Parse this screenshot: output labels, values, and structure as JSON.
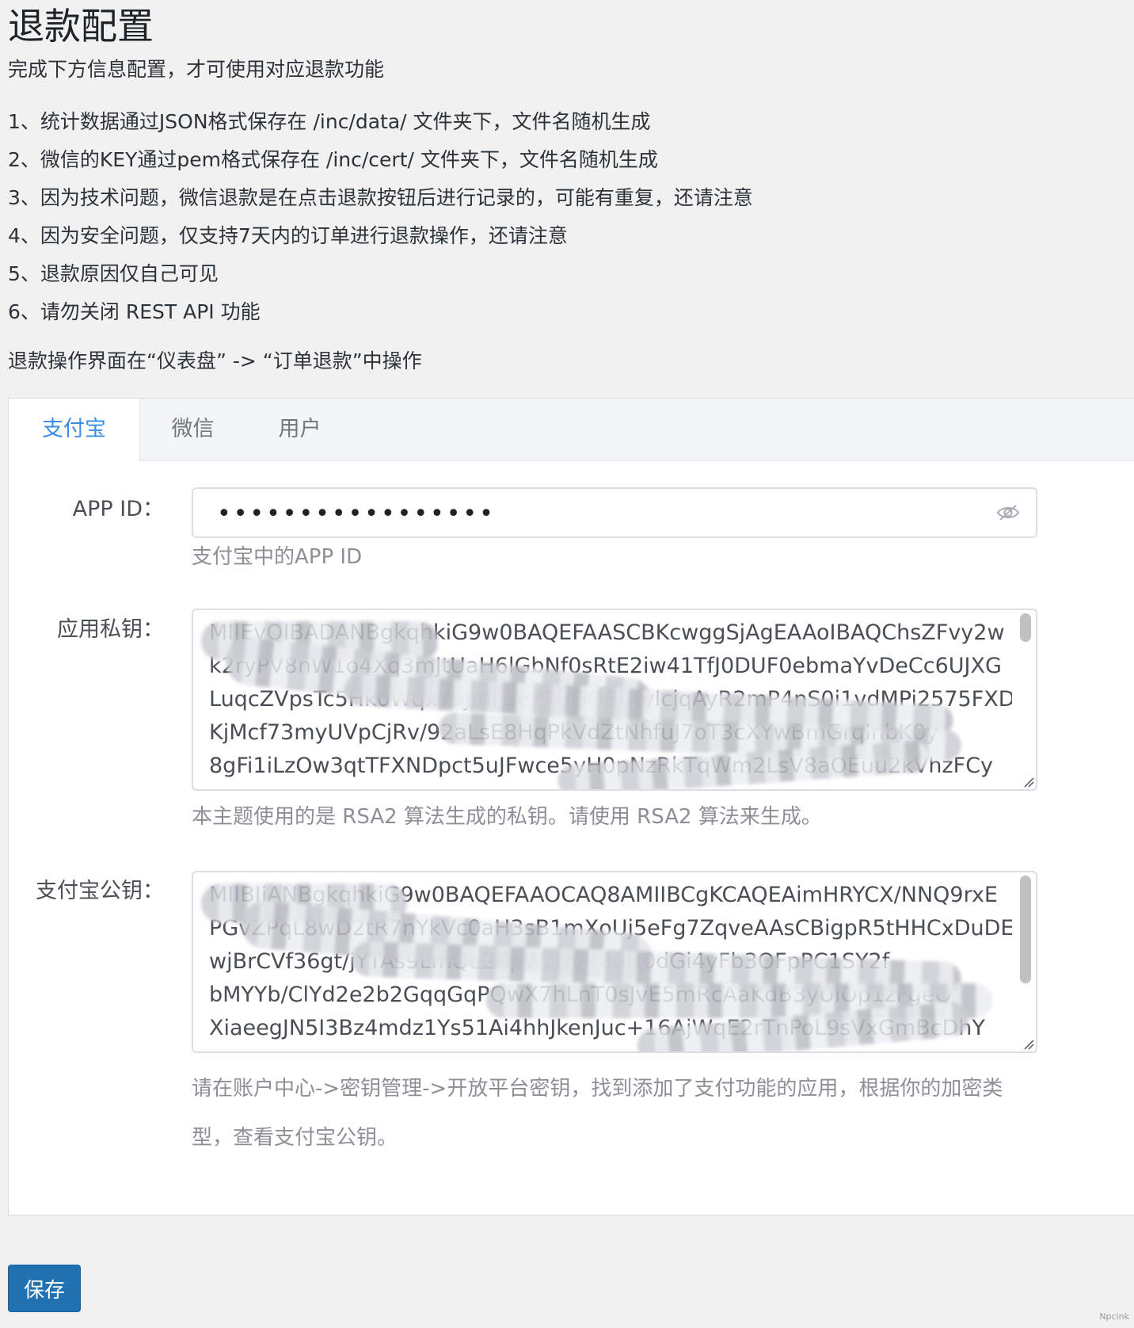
{
  "page": {
    "title": "退款配置",
    "subtitle": "完成下方信息配置，才可使用对应退款功能",
    "notes": [
      "1、统计数据通过JSON格式保存在 /inc/data/ 文件夹下，文件名随机生成",
      "2、微信的KEY通过pem格式保存在 /inc/cert/ 文件夹下，文件名随机生成",
      "3、因为技术问题，微信退款是在点击退款按钮后进行记录的，可能有重复，还请注意",
      "4、因为安全问题，仅支持7天内的订单进行退款操作，还请注意",
      "5、退款原因仅自己可见",
      "6、请勿关闭 REST API 功能"
    ],
    "nav_tip": "退款操作界面在“仪表盘” -> “订单退款”中操作"
  },
  "tabs": [
    {
      "label": "支付宝",
      "active": true
    },
    {
      "label": "微信",
      "active": false
    },
    {
      "label": "用户",
      "active": false
    }
  ],
  "form": {
    "app_id": {
      "label": "APP ID：",
      "value": "•••••••••••••••••",
      "help": "支付宝中的APP ID"
    },
    "private_key": {
      "label": "应用私钥：",
      "value": "MIIEvQIBADANBgkqhkiG9w0BAQEFAASCBKcwggSjAgEAAoIBAQChsZFvy2w\nk2ryPV8nW1o4Xq3mJtUaH6lGbNf0sRtE2iw41TfJ0DUF0ebmaYvDeCc6UJXG\nLuqcZVpsTc5Hk0WqxYbJmF3eP7uOO8UtvIcjqAyR2mP4nS0i1vdMPi2575FXD\nKjMcf73myUVpCjRv/92aLsE8HqPkVdZtNhfuJ7oT3cXYwBmGrqInbK0y\n8gFi1iLzOw3qtTFXNDpct5uJFwce5yH0pNzRkTqWm2LsV8aOEuu2kVhzFCy",
      "help": "本主题使用的是 RSA2 算法生成的私钥。请使用 RSA2 算法来生成。"
    },
    "alipay_public_key": {
      "label": "支付宝公钥：",
      "value": "MIIBIjANBgkqhkiG9w0BAQEFAAOCAQ8AMIIBCgKCAQEAimHRYCX/NNQ9rxE\nPGvZPqL8wD2tR7nYkVc0aH3sB1mXoUj5eFg7ZqveAAsCBigpR5tHHCxDuDEcWNa\nwjBrCVf36gt/jYTAs9LmQe2KpWzNvR8uH0dGi4yFb3OFpPC1SY2f\nbMYYb/ClYd2e2b2GqqGqPQwX7hLnT0sJvE5mRcAaKdB3yUiOp1zFgeQ\nXiaeegJN5I3Bz4mdz1Ys51Ai4hhJkenJuc+16AjWqE2rTnPoL9sVxGmBcDhY",
      "help": "请在账户中心->密钥管理->开放平台密钥，找到添加了支付功能的应用，根据你的加密类型，查看支付宝公钥。"
    }
  },
  "save_label": "保存",
  "watermark": "Npcink",
  "colors": {
    "accent": "#3b8ee6",
    "button": "#2271b1"
  }
}
